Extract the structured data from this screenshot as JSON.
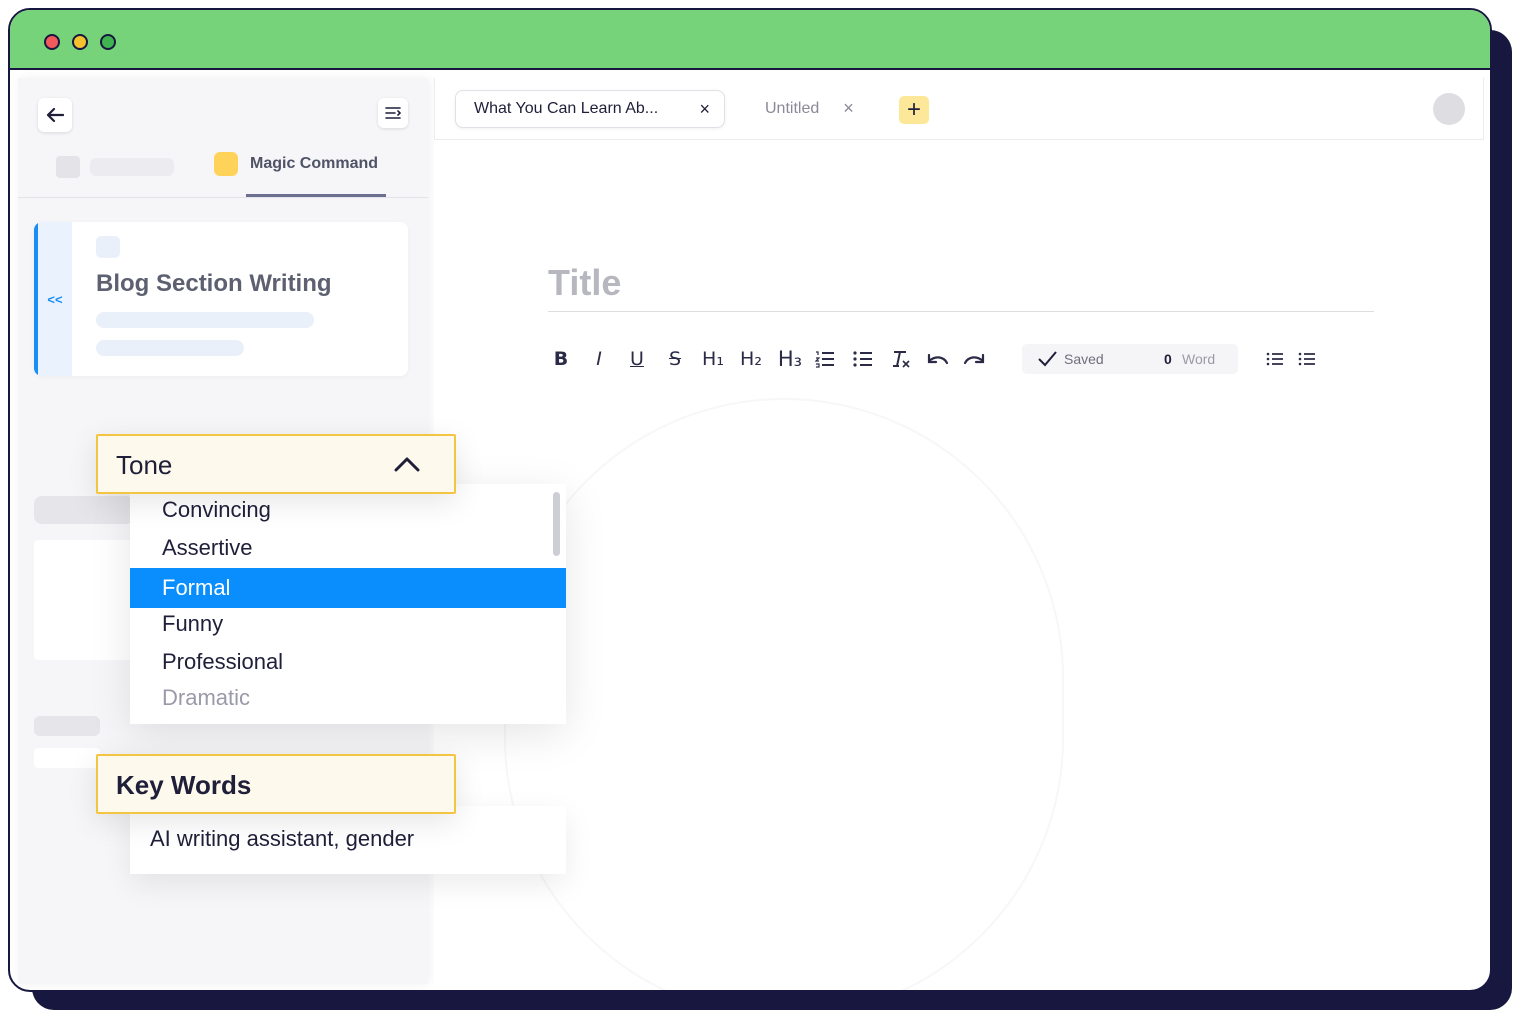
{
  "sidebar": {
    "tab_label": "Magic Command",
    "collapse_label": "<<",
    "template_title": "Blog Section Writing"
  },
  "tabs": [
    {
      "label": "What You Can Learn Ab...",
      "close": "×"
    },
    {
      "label": "Untitled",
      "close": "×"
    }
  ],
  "add_tab_label": "+",
  "editor": {
    "title_placeholder": "Title",
    "status": "Saved",
    "word_count": "0",
    "word_label": "Word"
  },
  "toolbar": {
    "bold": "B",
    "italic": "I",
    "underline": "U",
    "strike": "S",
    "h1": "H₁",
    "h2": "H₂",
    "h3": "H₃"
  },
  "tone": {
    "label": "Tone",
    "options": [
      "Convincing",
      "Assertive",
      "Formal",
      "Funny",
      "Professional",
      "Dramatic"
    ],
    "selected": "Formal"
  },
  "keywords": {
    "label": "Key Words",
    "value": "AI writing assistant, gender"
  },
  "colors": {
    "titlebar": "#77d37a",
    "frame": "#17173f",
    "selection": "#0a8dfd",
    "highlight_border": "#f4c542",
    "add_tab": "#fde89a"
  },
  "icons": {
    "back": "back-arrow-icon",
    "sidebar_menu": "menu-collapse-icon",
    "saved": "check-icon",
    "tone_toggle": "chevron-up-icon"
  }
}
